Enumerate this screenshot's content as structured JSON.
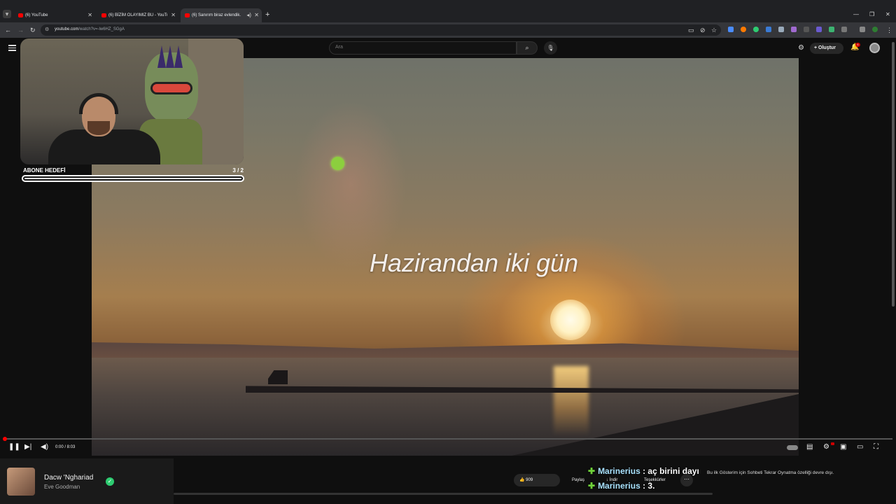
{
  "browser": {
    "tabs": [
      {
        "title": "(6) YouTube",
        "active": false
      },
      {
        "title": "(6) BİZİM OLAYIMIZ BU - YouTu",
        "active": false
      },
      {
        "title": "(6) Sanırım biraz evlendik.",
        "active": true
      }
    ],
    "url_host": "youtube.com",
    "url_path": "/watch?v=-lw6HZ_SGgA"
  },
  "masthead": {
    "search_placeholder": "Ara",
    "create_label": "Oluştur",
    "notification_count": "6"
  },
  "overlay": {
    "goal_label": "ABONE HEDEFİ",
    "goal_count": "3 / 2",
    "goal_progress": 1.0
  },
  "video": {
    "subtitle": "Hazirandan iki gün"
  },
  "player": {
    "time": "0:00 / 8:03",
    "progress": 0.0
  },
  "now_playing": {
    "title": "Dacw 'Nghariad",
    "artist": "Eve Goodman"
  },
  "actions": {
    "likes": "909",
    "share": "Paylaş",
    "download": "İndir",
    "thanks": "Teşekkürler"
  },
  "chat": [
    {
      "user": "Marinerius",
      "message": ": aç birini dayı"
    },
    {
      "user": "Marinerius",
      "message": ": 3."
    }
  ],
  "replay_note": "Bu ilk Gösterim için Sohbeti Tekrar Oynatma özelliği devre dışı."
}
